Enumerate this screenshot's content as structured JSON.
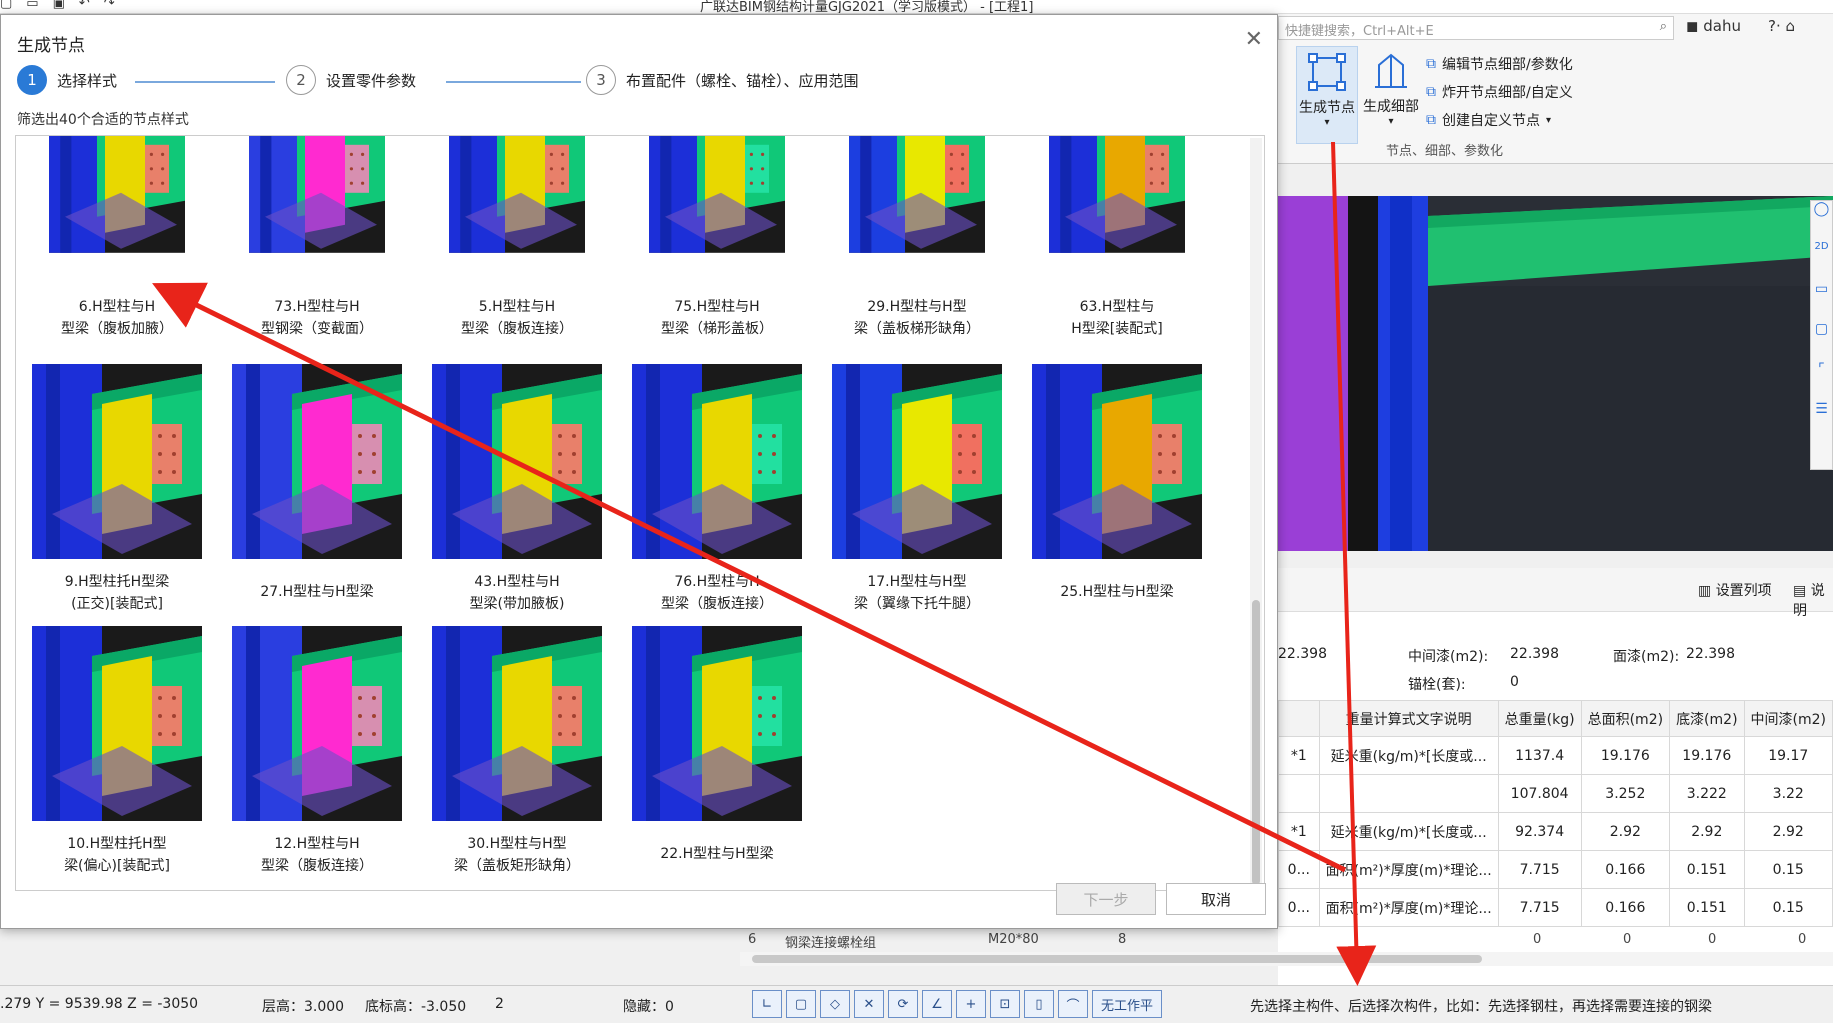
{
  "window": {
    "title": "广联达BIM钢结构计量GJG2021（学习版模式） - [工程1]",
    "qat_icons": [
      "new-file-icon",
      "open-folder-icon",
      "save-icon",
      "undo-icon",
      "redo-icon"
    ]
  },
  "ribbon": {
    "search_placeholder": "快捷键搜索，Ctrl+Alt+E",
    "user": "dahu",
    "help": "?·",
    "big_buttons": [
      {
        "label": "生成节点",
        "icon": "generate-node-icon"
      },
      {
        "label": "生成细部",
        "icon": "generate-detail-icon"
      }
    ],
    "small_buttons": [
      {
        "label": "编辑节点细部/参数化",
        "icon": "edit-node-icon"
      },
      {
        "label": "炸开节点细部/自定义",
        "icon": "explode-node-icon"
      },
      {
        "label": "创建自定义节点",
        "icon": "create-node-icon"
      }
    ],
    "group_label": "节点、细部、参数化"
  },
  "dialog": {
    "title": "生成节点",
    "steps": [
      {
        "num": "1",
        "label": "选择样式",
        "active": true
      },
      {
        "num": "2",
        "label": "设置零件参数",
        "active": false
      },
      {
        "num": "3",
        "label": "布置配件（螺栓、锚栓）、应用范围",
        "active": false
      }
    ],
    "filter_text": "筛选出40个合适的节点样式",
    "cards": [
      {
        "line1": "6.H型柱与H",
        "line2": "型梁（腹板加腋）"
      },
      {
        "line1": "73.H型柱与H",
        "line2": "型钢梁（变截面）"
      },
      {
        "line1": "5.H型柱与H",
        "line2": "型梁（腹板连接）"
      },
      {
        "line1": "75.H型柱与H",
        "line2": "型梁（梯形盖板）"
      },
      {
        "line1": "29.H型柱与H型",
        "line2": "梁（盖板梯形缺角）"
      },
      {
        "line1": "63.H型柱与",
        "line2": "H型梁[装配式]"
      },
      {
        "line1": "9.H型柱托H型梁",
        "line2": "(正交)[装配式]"
      },
      {
        "line1": "27.H型柱与H型梁",
        "line2": ""
      },
      {
        "line1": "43.H型柱与H",
        "line2": "型梁(带加腋板)"
      },
      {
        "line1": "76.H型柱与H",
        "line2": "型梁（腹板连接）"
      },
      {
        "line1": "17.H型柱与H型",
        "line2": "梁（翼缘下托牛腿）"
      },
      {
        "line1": "25.H型柱与H型梁",
        "line2": ""
      },
      {
        "line1": "10.H型柱托H型",
        "line2": "梁(偏心)[装配式]"
      },
      {
        "line1": "12.H型柱与H",
        "line2": "型梁（腹板连接）"
      },
      {
        "line1": "30.H型柱与H型",
        "line2": "梁（盖板矩形缺角）"
      },
      {
        "line1": "22.H型柱与H型梁",
        "line2": ""
      }
    ],
    "next_button": "下一步",
    "cancel_button": "取消"
  },
  "props": {
    "set_columns": "设置列项",
    "explain": "说明",
    "top_left_value": "22.398",
    "mid_paint_label": "中间漆(m2):",
    "mid_paint_value": "22.398",
    "top_paint_label": "面漆(m2):",
    "top_paint_value": "22.398",
    "anchor_label": "锚栓(套):",
    "anchor_value": "0",
    "headers": [
      "",
      "重量计算式文字说明",
      "总重量(kg)",
      "总面积(m2)",
      "底漆(m2)",
      "中间漆(m2)"
    ],
    "rows": [
      [
        "*1",
        "延米重(kg/m)*[长度或...",
        "1137.4",
        "19.176",
        "19.176",
        "19.17"
      ],
      [
        "",
        "",
        "107.804",
        "3.252",
        "3.222",
        "3.22"
      ],
      [
        "*1",
        "延米重(kg/m)*[长度或...",
        "92.374",
        "2.92",
        "2.92",
        "2.92"
      ],
      [
        "0...",
        "面积(m²)*厚度(m)*理论...",
        "7.715",
        "0.166",
        "0.151",
        "0.15"
      ],
      [
        "0...",
        "面积(m²)*厚度(m)*理论...",
        "7.715",
        "0.166",
        "0.151",
        "0.15"
      ]
    ],
    "partial_row": {
      "id": "6",
      "name": "钢梁连接螺栓组",
      "spec": "M20*80",
      "qty": "8",
      "vals": [
        "0",
        "0",
        "0",
        "0"
      ]
    }
  },
  "status": {
    "coords": ".279 Y = 9539.98 Z = -3050",
    "floor_height": "层高：3.000",
    "base_elevation": "底标高：-3.050",
    "floor_num": "2",
    "hidden": "隐藏：0",
    "no_plane": "无工作平",
    "hint": "先选择主构件、后选择次构件，比如：先选择钢柱，再选择需要连接的钢梁"
  },
  "colors": {
    "accent": "#2a7ad6",
    "annotation_red": "#e8241a",
    "steel_blue": "#1c2fd8",
    "steel_green": "#10c878",
    "steel_yellow": "#e8d800",
    "plate_salmon": "#e8806a"
  }
}
